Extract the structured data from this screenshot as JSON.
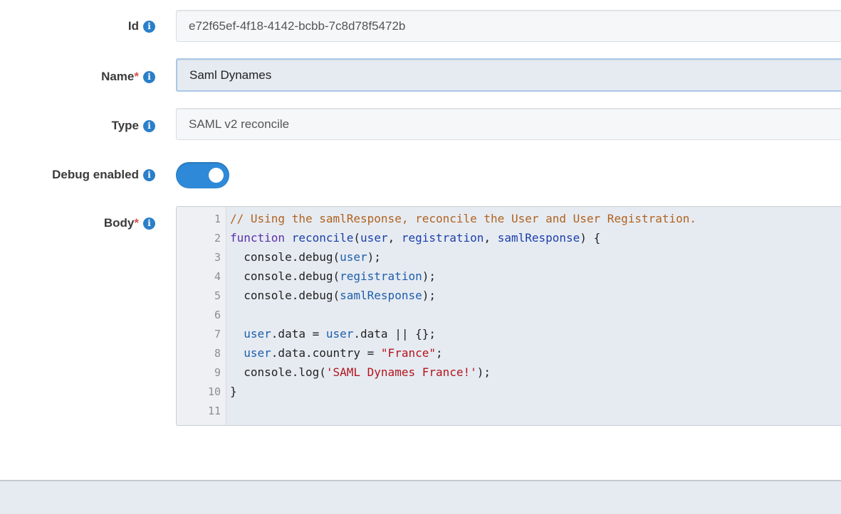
{
  "fields": {
    "id": {
      "label": "Id",
      "value": "e72f65ef-4f18-4142-bcbb-7c8d78f5472b"
    },
    "name": {
      "label": "Name",
      "required_mark": "*",
      "value": "Saml Dynames"
    },
    "type": {
      "label": "Type",
      "value": "SAML v2 reconcile"
    },
    "debug": {
      "label": "Debug enabled",
      "enabled": true
    },
    "body": {
      "label": "Body",
      "required_mark": "*"
    }
  },
  "info_icon_glyph": "i",
  "editor": {
    "line_numbers": [
      "1",
      "2",
      "3",
      "4",
      "5",
      "6",
      "7",
      "8",
      "9",
      "10",
      "11"
    ],
    "lines": [
      [
        {
          "t": "// Using the samlResponse, reconcile the User and User Registration.",
          "c": "c-comment"
        }
      ],
      [
        {
          "t": "function",
          "c": "c-kw"
        },
        {
          "t": " "
        },
        {
          "t": "reconcile",
          "c": "c-def"
        },
        {
          "t": "("
        },
        {
          "t": "user",
          "c": "c-def"
        },
        {
          "t": ", "
        },
        {
          "t": "registration",
          "c": "c-def"
        },
        {
          "t": ", "
        },
        {
          "t": "samlResponse",
          "c": "c-def"
        },
        {
          "t": ") {"
        }
      ],
      [
        {
          "t": "  console.debug("
        },
        {
          "t": "user",
          "c": "c-var"
        },
        {
          "t": ");"
        }
      ],
      [
        {
          "t": "  console.debug("
        },
        {
          "t": "registration",
          "c": "c-var"
        },
        {
          "t": ");"
        }
      ],
      [
        {
          "t": "  console.debug("
        },
        {
          "t": "samlResponse",
          "c": "c-var"
        },
        {
          "t": ");"
        }
      ],
      [
        {
          "t": ""
        }
      ],
      [
        {
          "t": "  "
        },
        {
          "t": "user",
          "c": "c-var"
        },
        {
          "t": ".data = "
        },
        {
          "t": "user",
          "c": "c-var"
        },
        {
          "t": ".data || {};"
        }
      ],
      [
        {
          "t": "  "
        },
        {
          "t": "user",
          "c": "c-var"
        },
        {
          "t": ".data.country = "
        },
        {
          "t": "\"France\"",
          "c": "c-str"
        },
        {
          "t": ";"
        }
      ],
      [
        {
          "t": "  console.log("
        },
        {
          "t": "'SAML Dynames France!'",
          "c": "c-str"
        },
        {
          "t": ");"
        }
      ],
      [
        {
          "t": "}"
        }
      ],
      [
        {
          "t": ""
        }
      ]
    ]
  },
  "colors": {
    "accent": "#2e8ad8",
    "required": "#d9534f",
    "info_icon": "#2a7fc9"
  }
}
